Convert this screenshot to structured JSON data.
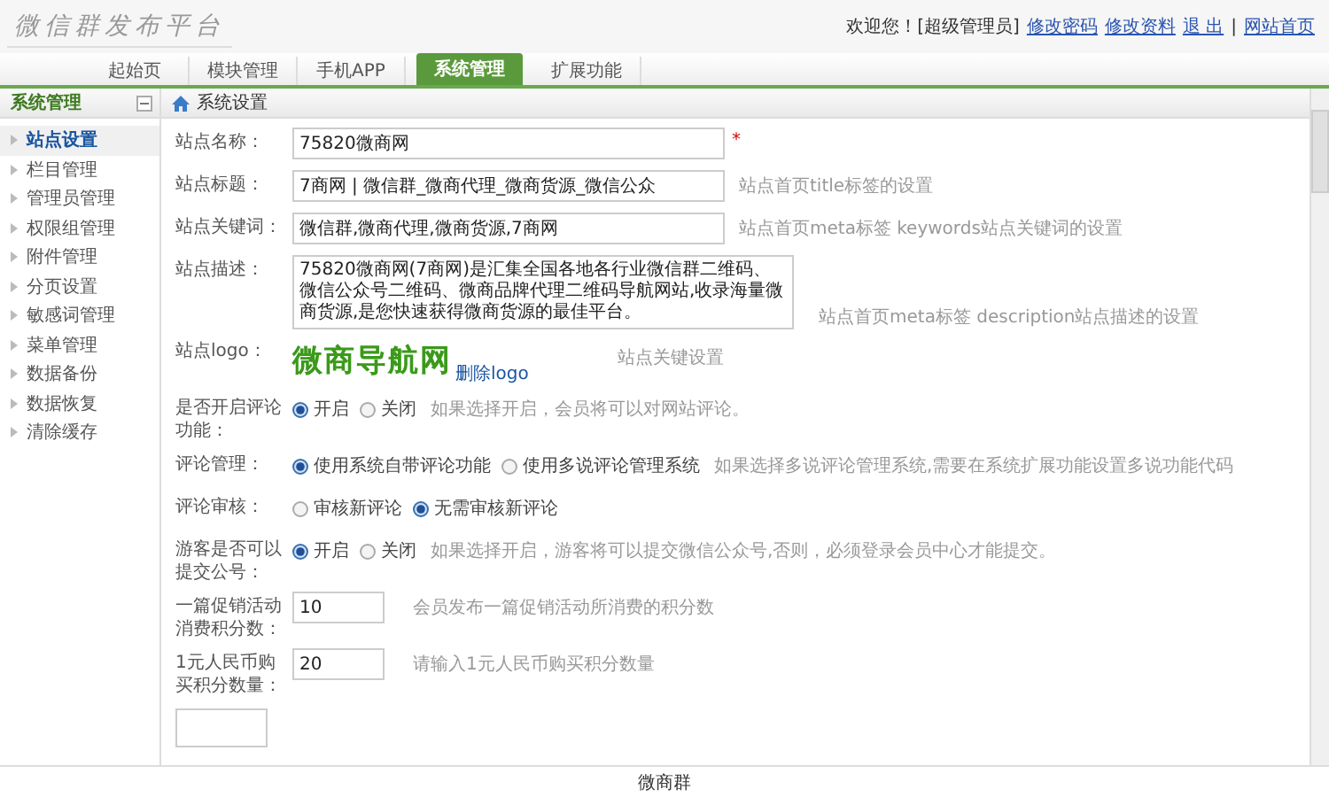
{
  "header": {
    "logo": "微信群发布平台",
    "welcome": "欢迎您！[超级管理员]",
    "links": [
      "修改密码",
      "修改资料",
      "退 出"
    ],
    "separator": "|",
    "home_link": "网站首页"
  },
  "tabs": [
    {
      "label": "起始页",
      "selected": false
    },
    {
      "label": "模块管理",
      "selected": false
    },
    {
      "label": "手机APP",
      "selected": false
    },
    {
      "label": "系统管理",
      "selected": true
    },
    {
      "label": "扩展功能",
      "selected": false
    }
  ],
  "sidebar": {
    "title": "系统管理",
    "items": [
      {
        "label": "站点设置",
        "selected": true
      },
      {
        "label": "栏目管理",
        "selected": false
      },
      {
        "label": "管理员管理",
        "selected": false
      },
      {
        "label": "权限组管理",
        "selected": false
      },
      {
        "label": "附件管理",
        "selected": false
      },
      {
        "label": "分页设置",
        "selected": false
      },
      {
        "label": "敏感词管理",
        "selected": false
      },
      {
        "label": "菜单管理",
        "selected": false
      },
      {
        "label": "数据备份",
        "selected": false
      },
      {
        "label": "数据恢复",
        "selected": false
      },
      {
        "label": "清除缓存",
        "selected": false
      }
    ]
  },
  "panel": {
    "title": "系统设置",
    "fields": [
      {
        "kind": "text",
        "label": "站点名称：",
        "value": "75820微商网",
        "required_mark": "*"
      },
      {
        "kind": "text",
        "label": "站点标题：",
        "value": "7商网 | 微信群_微商代理_微商货源_微信公众",
        "hint": "站点首页title标签的设置"
      },
      {
        "kind": "text",
        "label": "站点关键词：",
        "value": "微信群,微商代理,微商货源,7商网",
        "hint": "站点首页meta标签 keywords站点关键词的设置"
      },
      {
        "kind": "textarea",
        "label": "站点描述：",
        "value": "75820微商网(7商网)是汇集全国各地各行业微信群二维码、微信公众号二维码、微商品牌代理二维码导航网站,收录海量微商货源,是您快速获得微商货源的最佳平台。",
        "hint": "站点首页meta标签 description站点描述的设置"
      },
      {
        "kind": "logo",
        "label": "站点logo：",
        "logo_text": "微商导航网",
        "delete_link": "删除logo",
        "hint": "站点关键设置"
      },
      {
        "kind": "radio",
        "label": "是否开启评论功能：",
        "options": [
          {
            "label": "开启",
            "selected": true
          },
          {
            "label": "关闭",
            "selected": false
          }
        ],
        "hint": "如果选择开启，会员将可以对网站评论。"
      },
      {
        "kind": "radio",
        "label": "评论管理：",
        "options": [
          {
            "label": "使用系统自带评论功能",
            "selected": true
          },
          {
            "label": "使用多说评论管理系统",
            "selected": false
          }
        ],
        "hint": "如果选择多说评论管理系统,需要在系统扩展功能设置多说功能代码"
      },
      {
        "kind": "radio",
        "label": "评论审核：",
        "options": [
          {
            "label": "审核新评论",
            "selected": false
          },
          {
            "label": "无需审核新评论",
            "selected": true
          }
        ]
      },
      {
        "kind": "radio",
        "label": "游客是否可以提交公号：",
        "options": [
          {
            "label": "开启",
            "selected": true
          },
          {
            "label": "关闭",
            "selected": false
          }
        ],
        "hint": "如果选择开启，游客将可以提交微信公众号,否则，必须登录会员中心才能提交。"
      },
      {
        "kind": "number",
        "label": "一篇促销活动消费积分数：",
        "value": "10",
        "hint": "会员发布一篇促销活动所消费的积分数"
      },
      {
        "kind": "number",
        "label": "1元人民币购买积分数量：",
        "value": "20",
        "hint": "请输入1元人民币购买积分数量"
      },
      {
        "kind": "select"
      }
    ]
  },
  "footer": "微商群"
}
